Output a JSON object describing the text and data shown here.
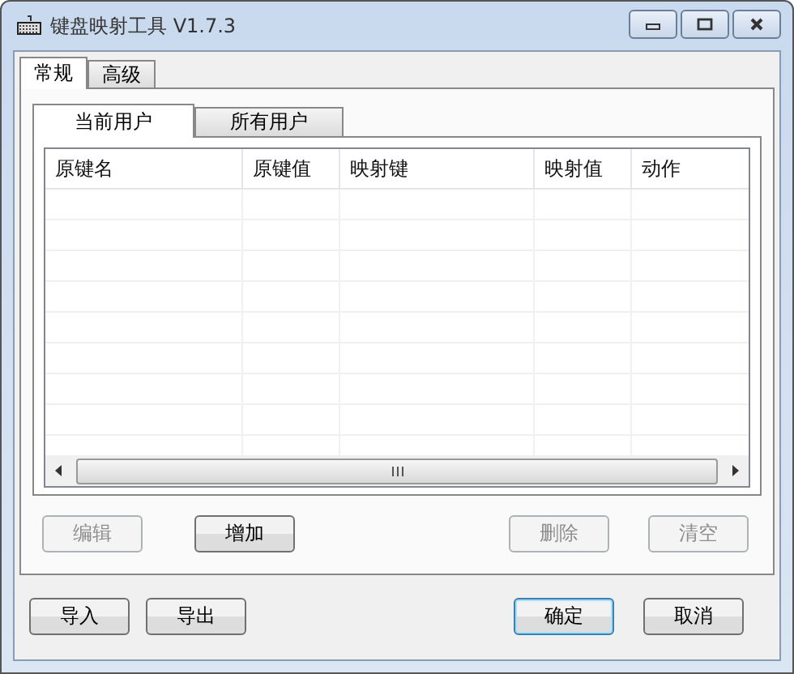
{
  "window": {
    "title": "键盘映射工具 V1.7.3"
  },
  "tabs": [
    {
      "label": "常规",
      "selected": true
    },
    {
      "label": "高级",
      "selected": false
    }
  ],
  "subtabs": [
    {
      "label": "当前用户",
      "selected": true
    },
    {
      "label": "所有用户",
      "selected": false
    }
  ],
  "table": {
    "columns": [
      "原键名",
      "原键值",
      "映射键",
      "映射值",
      "动作"
    ]
  },
  "list_buttons": [
    {
      "label": "编辑",
      "disabled": true
    },
    {
      "label": "增加",
      "disabled": false
    },
    {
      "label": "删除",
      "disabled": true
    },
    {
      "label": "清空",
      "disabled": true
    }
  ],
  "dialog_buttons": [
    {
      "label": "导入",
      "default": false
    },
    {
      "label": "导出",
      "default": false
    },
    {
      "label": "确定",
      "default": true
    },
    {
      "label": "取消",
      "default": false
    }
  ]
}
